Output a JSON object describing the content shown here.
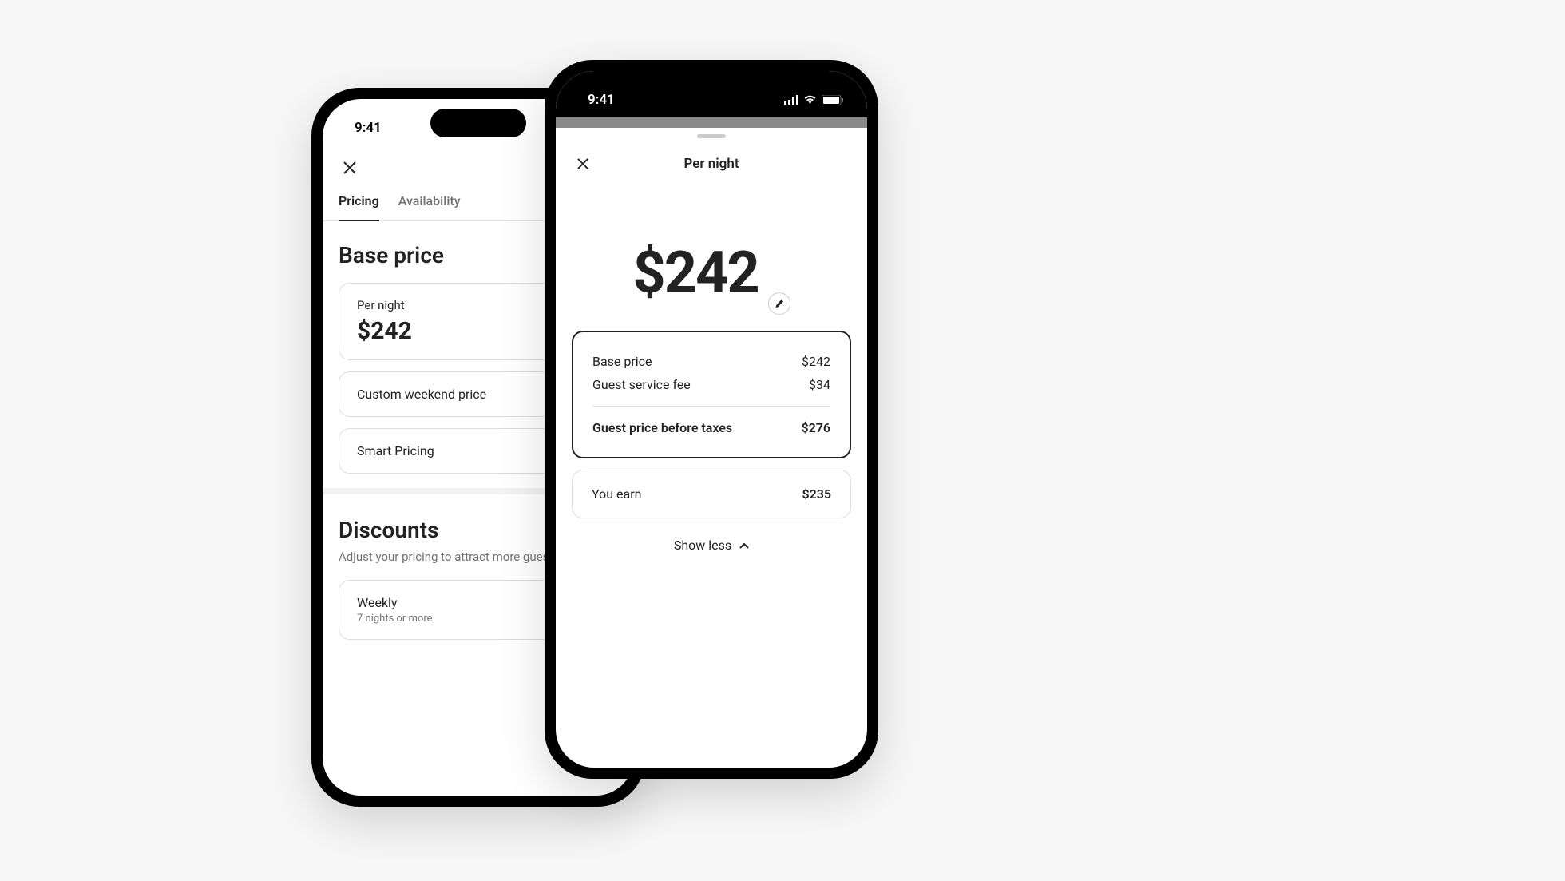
{
  "status": {
    "time": "9:41"
  },
  "phone_left": {
    "tabs": {
      "pricing": "Pricing",
      "availability": "Availability"
    },
    "base_price_section": {
      "title": "Base price",
      "per_night_card": {
        "label": "Per night",
        "price": "$242"
      },
      "custom_weekend": "Custom weekend price",
      "smart_pricing": "Smart Pricing"
    },
    "discounts_section": {
      "title": "Discounts",
      "subtitle": "Adjust your pricing to attract more guests.",
      "weekly": {
        "label": "Weekly",
        "sublabel": "7 nights or more"
      }
    }
  },
  "phone_right": {
    "title": "Per night",
    "big_price": "$242",
    "breakdown": {
      "base_label": "Base price",
      "base_value": "$242",
      "fee_label": "Guest service fee",
      "fee_value": "$34",
      "total_label": "Guest price before taxes",
      "total_value": "$276"
    },
    "earn": {
      "label": "You earn",
      "value": "$235"
    },
    "show_less": "Show less"
  }
}
